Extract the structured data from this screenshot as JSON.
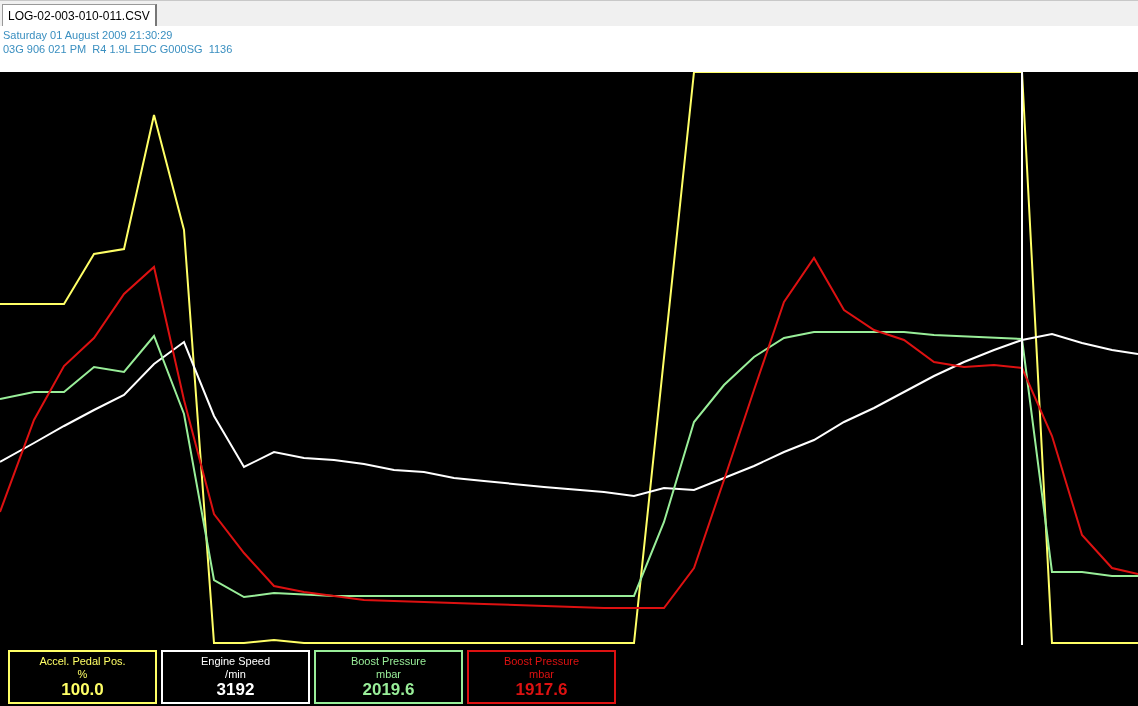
{
  "tabs": [
    {
      "label": "LOG-02-003-010-011.CSV",
      "selected": true
    }
  ],
  "header": {
    "date": "Saturday 01 August 2009 21:30:29",
    "ecu": "03G 906 021 PM  R4 1.9L EDC G000SG  1136"
  },
  "channels": [
    {
      "name": "Accel. Pedal Pos.",
      "unit": "%",
      "reading": "100.0",
      "color": "#ffff66"
    },
    {
      "name": "Engine Speed",
      "unit": "/min",
      "reading": "3192",
      "color": "#ffffff"
    },
    {
      "name": "Boost Pressure",
      "unit": "mbar",
      "reading": "2019.6",
      "color": "#99ee99"
    },
    {
      "name": "Boost Pressure",
      "unit": "mbar",
      "reading": "1917.6",
      "color": "#dd1111"
    }
  ]
}
